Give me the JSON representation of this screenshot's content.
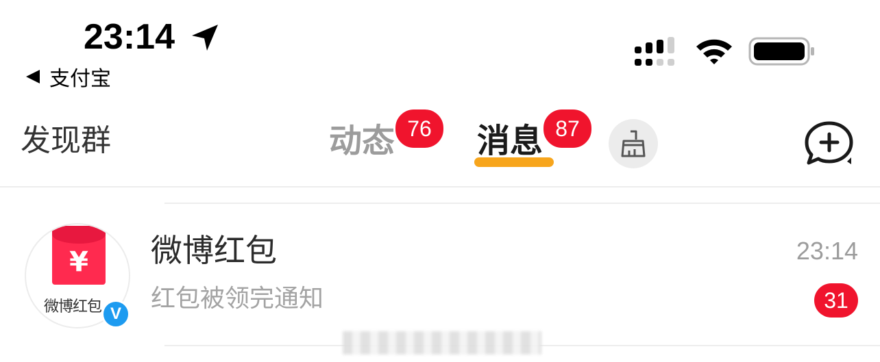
{
  "status_bar": {
    "time": "23:14",
    "back_app": "支付宝",
    "icons": [
      "location-arrow-icon",
      "cellular-signal-icon",
      "wifi-icon",
      "battery-icon"
    ]
  },
  "header": {
    "discover_label": "发现群",
    "tabs": [
      {
        "label": "动态",
        "badge": "76",
        "active": false
      },
      {
        "label": "消息",
        "badge": "87",
        "active": true
      }
    ],
    "accent_color": "#f7a51c",
    "badge_color": "#f0142d",
    "icons": [
      "broom-icon",
      "compose-message-icon"
    ]
  },
  "conversations": [
    {
      "name": "微博红包",
      "preview": "红包被领完通知",
      "time": "23:14",
      "unread": "31",
      "avatar_caption": "微博红包",
      "avatar_symbol": "¥",
      "verified_mark": "V"
    }
  ]
}
